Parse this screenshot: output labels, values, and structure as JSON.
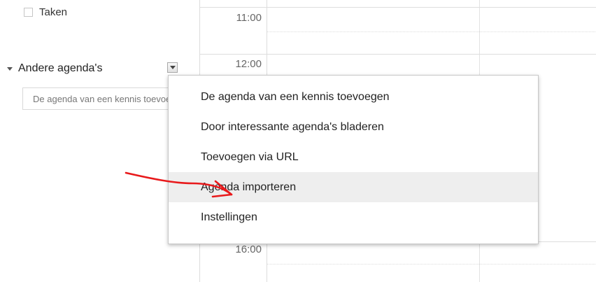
{
  "sidebar": {
    "tasks_label": "Taken",
    "other_calendars_label": "Andere agenda's",
    "friend_input_placeholder": "De agenda van een kennis toevoegen"
  },
  "grid": {
    "time_labels": [
      "11:00",
      "12:00",
      "16:00"
    ]
  },
  "menu": {
    "items": [
      "De agenda van een kennis toevoegen",
      "Door interessante agenda's bladeren",
      "Toevoegen via URL",
      "Agenda importeren",
      "Instellingen"
    ],
    "hover_item": "Agenda importeren"
  },
  "colors": {
    "annotation_arrow": "#e8191b",
    "menu_hover": "#eeeeee"
  },
  "icons": {
    "section_toggle": "triangle-down-icon",
    "calendar_options": "dropdown-arrow-icon"
  }
}
